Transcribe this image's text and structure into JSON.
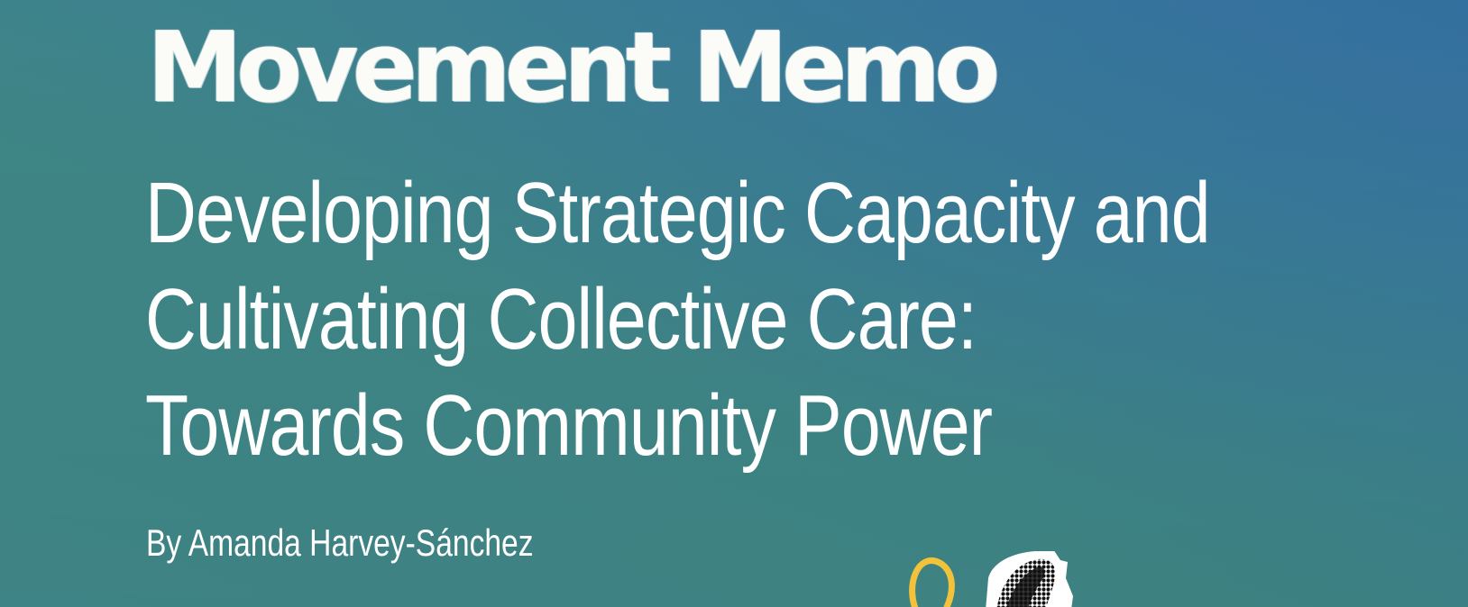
{
  "cover": {
    "series_title": "Movement Memo",
    "headline_lines": [
      "Developing Strategic Capacity and",
      "Cultivating Collective Care:",
      "Towards Community Power"
    ],
    "byline": "By Amanda Harvey-Sánchez"
  },
  "colors": {
    "background_teal": "#41888a",
    "background_blue": "#35729e",
    "text": "#ffffff",
    "accent_yellow": "#f2c23a"
  },
  "illustration": {
    "icon": "collage-hand-icon"
  }
}
